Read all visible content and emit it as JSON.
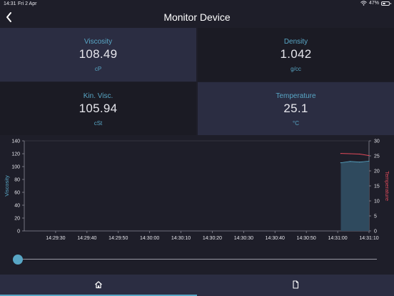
{
  "status": {
    "time": "14:31",
    "date": "Fri 2 Apr",
    "battery": "47%"
  },
  "nav": {
    "title": "Monitor Device"
  },
  "tiles": {
    "viscosity": {
      "label": "Viscosity",
      "value": "108.49",
      "unit": "cP"
    },
    "density": {
      "label": "Density",
      "value": "1.042",
      "unit": "g/cc"
    },
    "kin_visc": {
      "label": "Kin. Visc.",
      "value": "105.94",
      "unit": "cSt"
    },
    "temperature": {
      "label": "Temperature",
      "value": "25.1",
      "unit": "°C"
    }
  },
  "colors": {
    "accent": "#58a6c5",
    "temperature_line": "#e24a5a",
    "area_fill": "#2f4a5e",
    "tile_dark": "#1b1b24",
    "tile_light": "#2b2d42"
  },
  "chart_data": {
    "type": "line",
    "ylabel_left": "Viscosity",
    "ylabel_right": "Temperature",
    "x_ticks": [
      "14:29:30",
      "14:29:40",
      "14:29:50",
      "14:30:00",
      "14:30:10",
      "14:30:20",
      "14:30:30",
      "14:30:40",
      "14:30:50",
      "14:31:00",
      "14:31:10"
    ],
    "y_left_ticks": [
      "0",
      "20",
      "40",
      "60",
      "80",
      "100",
      "120",
      "140"
    ],
    "y_right_ticks": [
      "0",
      "5",
      "10",
      "15",
      "20",
      "25",
      "30"
    ],
    "y_left_range": [
      0,
      140
    ],
    "y_right_range": [
      0,
      30
    ],
    "x_range_seconds_after_14_29_20": [
      0,
      110
    ],
    "series": [
      {
        "name": "Viscosity",
        "axis": "left",
        "style": "area",
        "x_seconds": [
          101,
          104,
          107,
          110
        ],
        "values": [
          106,
          108,
          107,
          108.49
        ]
      },
      {
        "name": "Temperature",
        "axis": "right",
        "style": "line",
        "x_seconds": [
          101,
          104,
          107,
          110
        ],
        "values": [
          25.8,
          25.7,
          25.6,
          25.1
        ]
      }
    ],
    "grid": false
  },
  "slider": {
    "value_fraction": 0
  },
  "tabs": {
    "home": "home-icon",
    "document": "document-icon"
  }
}
